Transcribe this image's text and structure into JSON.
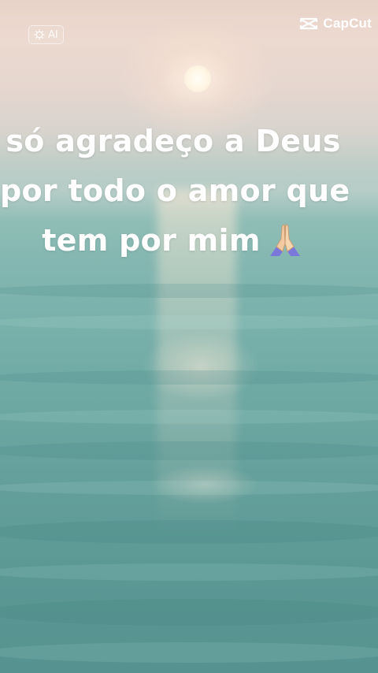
{
  "badge": {
    "label": "AI",
    "icon": "sparkle-gear-icon"
  },
  "brand": {
    "name": "CapCut",
    "icon": "capcut-logo-icon"
  },
  "caption": {
    "lines": [
      "só agradeço a Deus",
      "por todo o amor que",
      "tem por mim"
    ],
    "emoji": "🙏",
    "emoji_icon": "praying-hands-icon"
  },
  "colors": {
    "text": "#ffffff",
    "sea": "#6ea8a3",
    "sky": "#e9d3c9"
  }
}
